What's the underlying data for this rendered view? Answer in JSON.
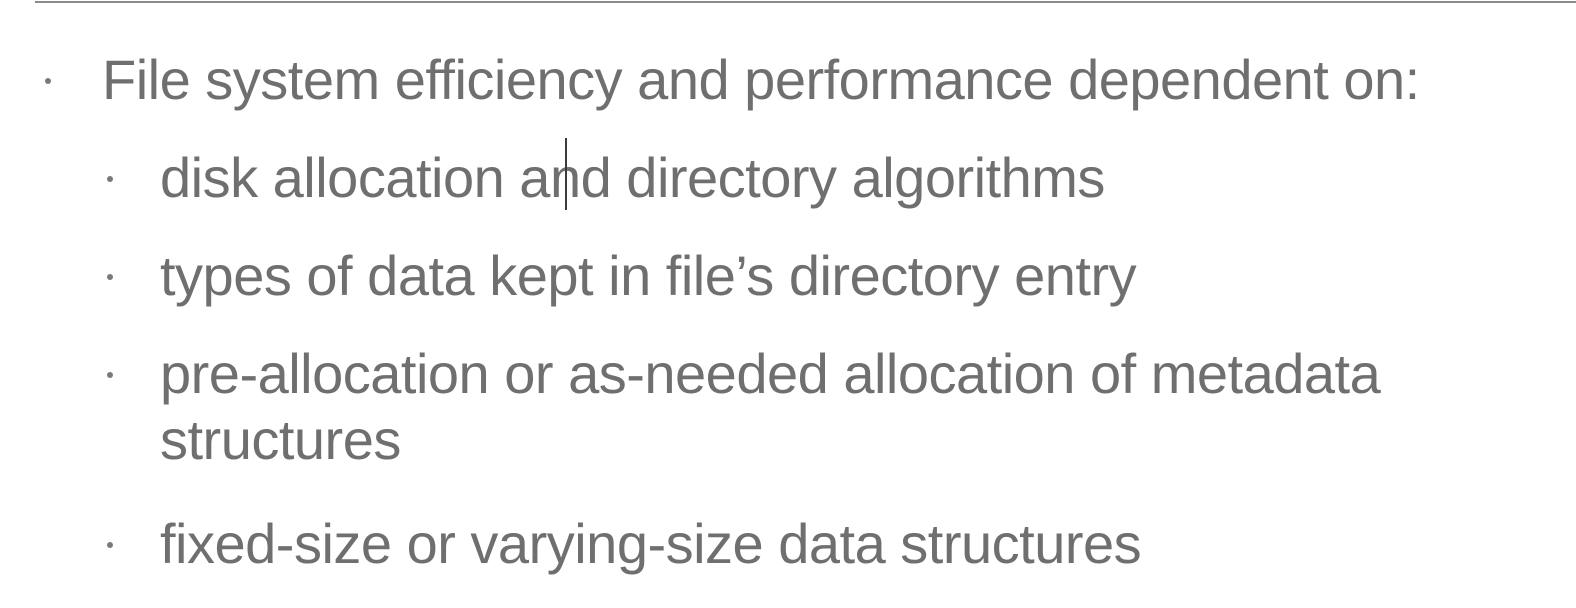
{
  "slide": {
    "bullets": [
      {
        "level": 1,
        "text": "File system efficiency and performance dependent on:"
      },
      {
        "level": 2,
        "text": "disk allocation and directory algorithms"
      },
      {
        "level": 2,
        "text": "types of data kept in file’s directory entry"
      },
      {
        "level": 2,
        "text_line1": "pre-allocation or as-needed allocation of metadata",
        "text_line2": "structures"
      },
      {
        "level": 2,
        "text": "fixed-size or varying-size data structures"
      }
    ]
  }
}
